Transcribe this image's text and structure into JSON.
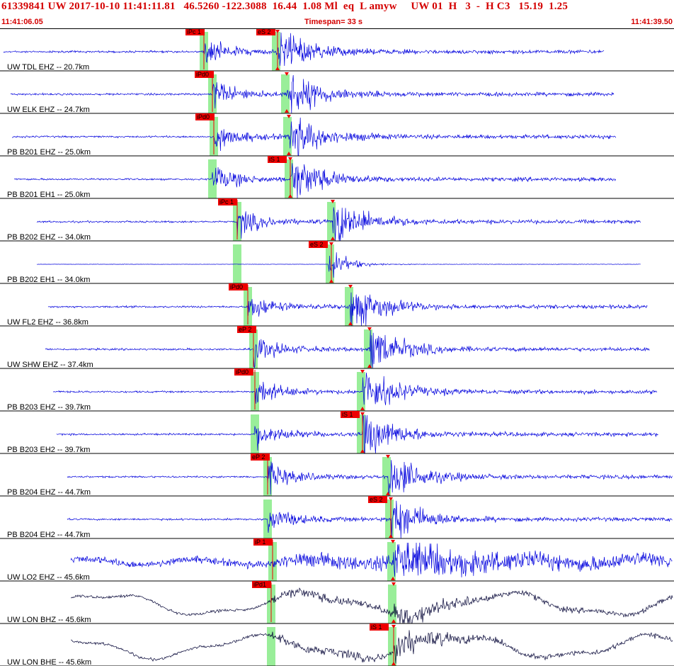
{
  "header": {
    "title": "61339841 UW 2017-10-10 11:41:11.81   46.5260 -122.3088  16.44  1.08 Ml  eq  L amyw     UW 01  H   3  -  H C3   15.19  1.25",
    "start_time": "11:41:06.05",
    "end_time": "11:41:39.50",
    "timespan": "Timespan=  33 s"
  },
  "colors": {
    "trace": "#0000dd",
    "trace_broadband": "#000033",
    "pick": "#ee0000",
    "window": "#99ee99",
    "text": "#d40000"
  },
  "traces": [
    {
      "label": "UW TDL EHZ -- 20.7km",
      "type": "noisy",
      "picks": [
        {
          "label": "iPc 1",
          "kind": "P"
        },
        {
          "label": "eS 2",
          "kind": "S"
        }
      ]
    },
    {
      "label": "UW ELK EHZ -- 24.7km",
      "type": "noisy",
      "picks": [
        {
          "label": "iPd0",
          "kind": "P"
        }
      ]
    },
    {
      "label": "PB B201 EHZ -- 25.0km",
      "type": "noisy",
      "picks": [
        {
          "label": "iPd0",
          "kind": "P"
        }
      ]
    },
    {
      "label": "PB B201 EH1 -- 25.0km",
      "type": "noisy",
      "picks": [
        {
          "label": "iS 1",
          "kind": "S"
        }
      ]
    },
    {
      "label": "PB B202 EHZ -- 34.0km",
      "type": "noisy",
      "picks": [
        {
          "label": "iPc 1",
          "kind": "P"
        }
      ]
    },
    {
      "label": "PB B202 EH1 -- 34.0km",
      "type": "quiet",
      "picks": [
        {
          "label": "eS 2",
          "kind": "S"
        }
      ]
    },
    {
      "label": "UW FL2 EHZ -- 36.8km",
      "type": "noisy",
      "picks": [
        {
          "label": "iPd0",
          "kind": "P"
        }
      ]
    },
    {
      "label": "UW SHW EHZ -- 37.4km",
      "type": "noisy",
      "picks": [
        {
          "label": "eP 2",
          "kind": "P"
        }
      ]
    },
    {
      "label": "PB B203 EHZ -- 39.7km",
      "type": "noisy",
      "picks": [
        {
          "label": "iPd0",
          "kind": "P"
        }
      ]
    },
    {
      "label": "PB B203 EH2 -- 39.7km",
      "type": "noisy",
      "picks": [
        {
          "label": "iS 1",
          "kind": "S"
        }
      ]
    },
    {
      "label": "PB B204 EHZ -- 44.7km",
      "type": "noisy",
      "picks": [
        {
          "label": "eP 2",
          "kind": "P"
        }
      ]
    },
    {
      "label": "PB B204 EH2 -- 44.7km",
      "type": "noisy",
      "picks": [
        {
          "label": "eS 2",
          "kind": "S"
        }
      ]
    },
    {
      "label": "UW LO2 EHZ -- 45.6km",
      "type": "wavy",
      "picks": [
        {
          "label": "iP 1",
          "kind": "P"
        }
      ]
    },
    {
      "label": "UW LON BHZ -- 45.6km",
      "type": "broadband",
      "picks": [
        {
          "label": "iPd1",
          "kind": "P"
        }
      ]
    },
    {
      "label": "UW LON BHE -- 45.6km",
      "type": "broadband",
      "picks": [
        {
          "label": "iS 1",
          "kind": "S"
        }
      ]
    }
  ]
}
